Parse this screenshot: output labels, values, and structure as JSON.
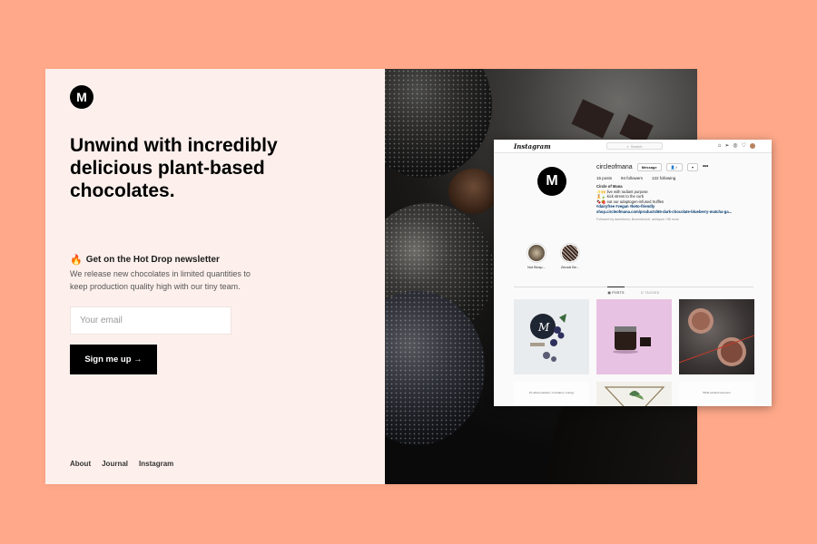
{
  "brand": {
    "logo_letter": "M"
  },
  "hero": {
    "headline": "Unwind with incredibly delicious plant-based chocolates."
  },
  "newsletter": {
    "icon": "🔥",
    "title": "Get on the Hot Drop newsletter",
    "description": "We release new chocolates in limited quantities to keep production quality high with our tiny team.",
    "email_placeholder": "Your email",
    "button_label": "Sign me up →"
  },
  "footer": {
    "links": [
      "About",
      "Journal",
      "Instagram"
    ]
  },
  "instagram": {
    "brand": "Instagram",
    "search_placeholder": "Search",
    "profile_letter": "M",
    "username": "circleofmana",
    "message_label": "Message",
    "follow_label": "✓",
    "more_label": "•••",
    "stats": {
      "posts": "15 posts",
      "followers": "94 followers",
      "following": "122 following"
    },
    "bio": {
      "name": "Circle of Mana",
      "line1": "✨🙌 live with radiant purpose",
      "line2": "🧘🍃 kick stress to the curb",
      "line3": "🍫🍓 eat our adaptogen-infused truffles",
      "tags": "#dairyfree #vegan #keto-friendly",
      "link": "shop.circleofmana.com/products/65-dark-chocolate-blueberry-matcha-ga...",
      "followed_by": "Followed by danieleem, illumedsorrel, aellapan +58 more"
    },
    "highlights": [
      "Nut Blosp...",
      "Zenzal Be..."
    ],
    "tabs": {
      "posts": "▦ POSTS",
      "tagged": "⊡ TAGGED"
    },
    "grid_captions": {
      "tile4": "It's about passion, innovation, energy",
      "tile6": "What excited someone"
    }
  }
}
